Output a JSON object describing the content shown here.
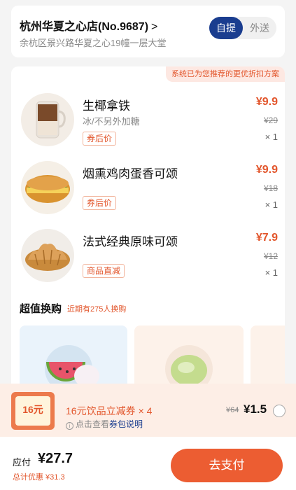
{
  "store": {
    "name": "杭州华夏之心店(No.9687)",
    "chevron": ">",
    "address": "余杭区景兴路华夏之心19幢一层大堂",
    "modes": [
      "自提",
      "外送"
    ],
    "selected_mode": "自提"
  },
  "order": {
    "promo_tag": "系统已为您推荐的更优折扣方案",
    "items": [
      {
        "name": "生椰拿铁",
        "spec": "冰/不另外加糖",
        "badge": "券后价",
        "price": "¥9.9",
        "original": "¥29",
        "qty": "× 1",
        "icon": "iced-coconut-latte-image"
      },
      {
        "name": "烟熏鸡肉蛋香可颂",
        "spec": "",
        "badge": "券后价",
        "price": "¥9.9",
        "original": "¥18",
        "qty": "× 1",
        "icon": "chicken-egg-croissant-image"
      },
      {
        "name": "法式经典原味可颂",
        "spec": "",
        "badge": "商品直减",
        "price": "¥7.9",
        "original": "¥12",
        "qty": "× 1",
        "icon": "plain-croissant-image"
      }
    ],
    "upgrade": {
      "title": "超值换购",
      "subtitle": "近期有275人换购"
    }
  },
  "coupon": {
    "ticket": "16元",
    "title": "16元饮品立减券",
    "multiplier": "× 4",
    "info_prefix": "点击查看",
    "info_link": "券包说明",
    "original": "¥64",
    "price": "¥1.5",
    "selected": false
  },
  "footer": {
    "due_label": "应付",
    "due_amount": "¥27.7",
    "discount": "总计优惠 ¥31.3",
    "pay_label": "去支付"
  },
  "colors": {
    "accent": "#e2552b",
    "pay_button": "#ec5d32",
    "brand_blue": "#1a3d8f"
  }
}
